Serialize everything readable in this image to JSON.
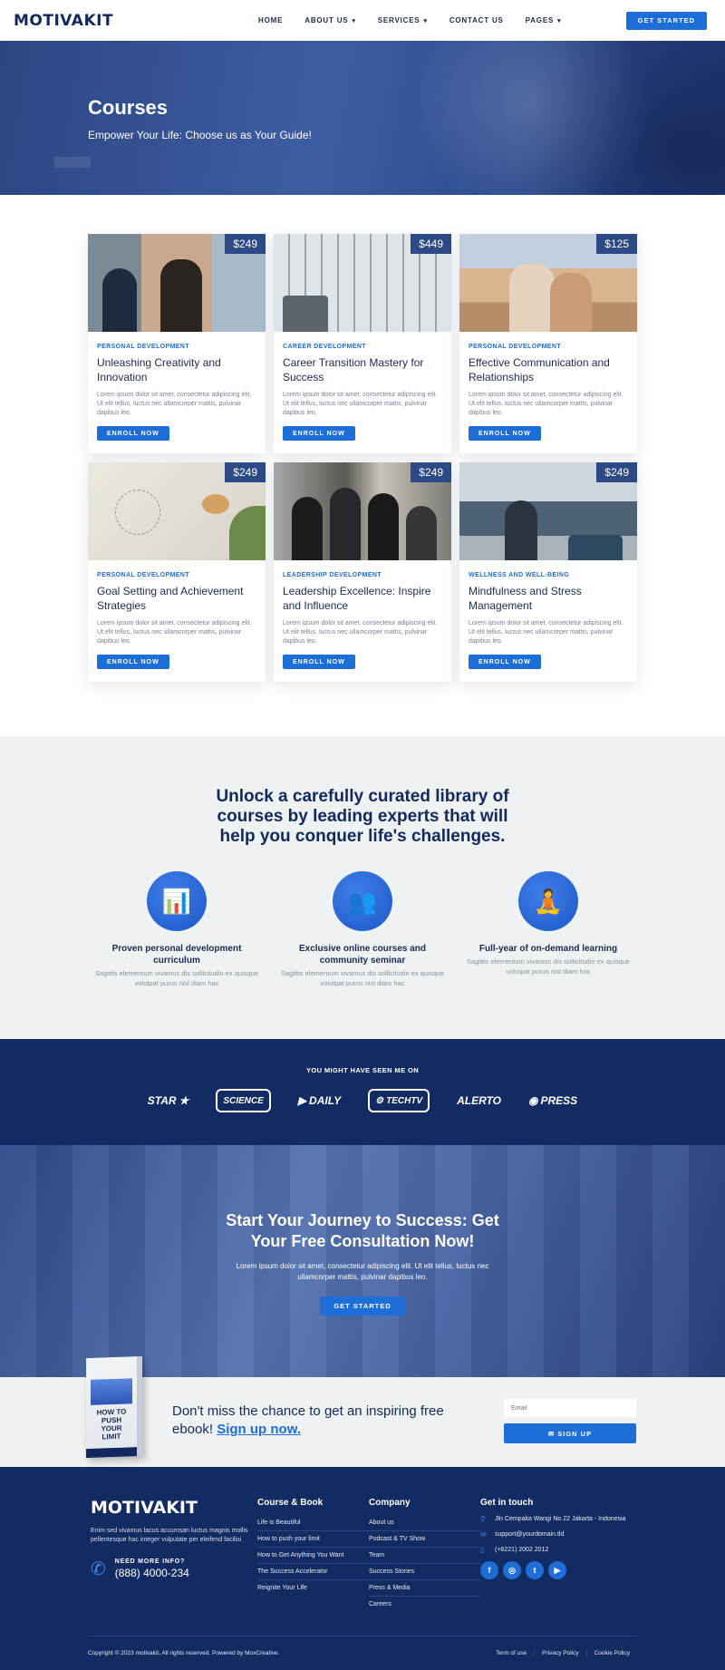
{
  "header": {
    "logo": "MOTIVAKIT",
    "nav": [
      {
        "label": "HOME",
        "dropdown": false
      },
      {
        "label": "ABOUT US",
        "dropdown": true
      },
      {
        "label": "SERVICES",
        "dropdown": true
      },
      {
        "label": "CONTACT US",
        "dropdown": false
      },
      {
        "label": "PAGES",
        "dropdown": true
      }
    ],
    "cta": "GET STARTED"
  },
  "hero": {
    "title": "Courses",
    "subtitle": "Empower Your Life: Choose us as Your Guide!"
  },
  "courses": [
    {
      "price": "$249",
      "category": "PERSONAL DEVELOPMENT",
      "title": "Unleashing Creativity and Innovation",
      "desc": "Lorem ipsum dolor sit amet, consectetur adipiscing elit. Ut elit tellus, luctus nec ullamcorper mattis, pulvinar dapibus leo.",
      "button": "ENROLL NOW"
    },
    {
      "price": "$449",
      "category": "CAREER DEVELOPMENT",
      "title": "Career Transition Mastery for Success",
      "desc": "Lorem ipsum dolor sit amet, consectetur adipiscing elit. Ut elit tellus, luctus nec ullamcorper mattis, pulvinar dapibus leo.",
      "button": "ENROLL NOW"
    },
    {
      "price": "$125",
      "category": "PERSONAL DEVELOPMENT",
      "title": "Effective Communication and Relationships",
      "desc": "Lorem ipsum dolor sit amet, consectetur adipiscing elit. Ut elit tellus, luctus nec ullamcorper mattis, pulvinar dapibus leo.",
      "button": "ENROLL NOW"
    },
    {
      "price": "$249",
      "category": "PERSONAL DEVELOPMENT",
      "title": "Goal Setting and Achievement Strategies",
      "desc": "Lorem ipsum dolor sit amet, consectetur adipiscing elit. Ut elit tellus, luctus nec ullamcorper mattis, pulvinar dapibus leo.",
      "button": "ENROLL NOW"
    },
    {
      "price": "$249",
      "category": "LEADERSHIP DEVELOPMENT",
      "title": "Leadership Excellence: Inspire and Influence",
      "desc": "Lorem ipsum dolor sit amet, consectetur adipiscing elit. Ut elit tellus, luctus nec ullamcorper mattis, pulvinar dapibus leo.",
      "button": "ENROLL NOW"
    },
    {
      "price": "$249",
      "category": "WELLNESS AND WELL-BEING",
      "title": "Mindfulness and Stress Management",
      "desc": "Lorem ipsum dolor sit amet, consectetur adipiscing elit. Ut elit tellus, luctus nec ullamcorper mattis, pulvinar dapibus leo.",
      "button": "ENROLL NOW"
    }
  ],
  "features": {
    "heading": "Unlock a carefully curated library of courses by leading experts that will help you conquer life's challenges.",
    "items": [
      {
        "title": "Proven personal development curriculum",
        "desc": "Sagittis elementum vivamus dis sollicitudin ex quisque volutpat purus nisl diam hac"
      },
      {
        "title": "Exclusive online courses and community seminar",
        "desc": "Sagittis elementum vivamus dis sollicitudin ex quisque volutpat purus nisl diam hac"
      },
      {
        "title": "Full-year of on-demand learning",
        "desc": "Sagittis elementum vivamus dis sollicitudin ex quisque volutpat purus nisl diam hac"
      }
    ]
  },
  "seen": {
    "title": "YOU MIGHT HAVE SEEN ME ON",
    "brands": [
      "STAR",
      "SCIENCE",
      "DAILY",
      "TECHTV",
      "ALERTO",
      "PRESS"
    ]
  },
  "cta": {
    "heading": "Start Your Journey to Success: Get Your Free Consultation Now!",
    "text": "Lorem ipsum dolor sit amet, consectetur adipiscing elit. Ut elit tellus, luctus nec ullamcorper mattis, pulvinar dapibus leo.",
    "button": "GET STARTED"
  },
  "newsletter": {
    "book_title": "HOW TO PUSH YOUR LIMIT",
    "text": "Don't miss the chance to get an inspiring free ebook!",
    "link": "Sign up now.",
    "email_placeholder": "Email",
    "button": "✉ SIGN UP"
  },
  "footer": {
    "logo": "MOTIVAKIT",
    "desc": "Enim sed vivamus lacus accumsan luctus magnis mollis pellentesque hac integer vulputate per eleifend facilisi",
    "need_label": "NEED MORE INFO?",
    "phone": "(888) 4000-234",
    "col1": {
      "title": "Course & Book",
      "links": [
        "Life is Beautiful",
        "How to push your limit",
        "How to Get Anything You Want",
        "The Success Accelerator",
        "Reignite Your Life"
      ]
    },
    "col2": {
      "title": "Company",
      "links": [
        "About us",
        "Podcast & TV Show",
        "Team",
        "Success Stories",
        "Press & Media",
        "Careers"
      ]
    },
    "contact": {
      "title": "Get in touch",
      "address": "Jln Cempaka Wangi No 22 Jakarta - Indonesia",
      "email": "support@yourdomain.tld",
      "phone": "(+6221) 2002 2012"
    },
    "copyright": "Copyright © 2023 motivakit, All rights reserved. Powered by MoxCreative.",
    "legal": [
      "Term of use",
      "Privacy Policy",
      "Cookie Policy"
    ]
  }
}
